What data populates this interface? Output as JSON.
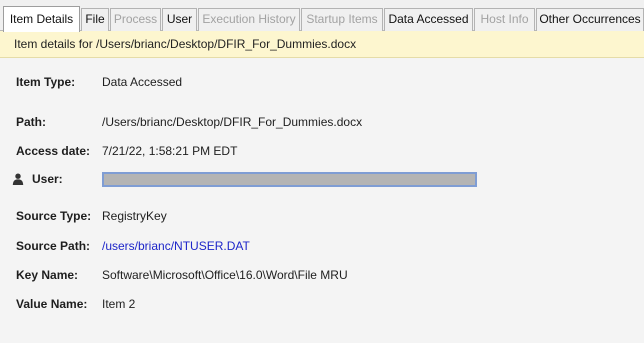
{
  "tabs": [
    {
      "label": "Item Details",
      "state": "active"
    },
    {
      "label": "File",
      "state": "enabled"
    },
    {
      "label": "Process",
      "state": "disabled"
    },
    {
      "label": "User",
      "state": "enabled"
    },
    {
      "label": "Execution History",
      "state": "disabled"
    },
    {
      "label": "Startup Items",
      "state": "disabled"
    },
    {
      "label": "Data Accessed",
      "state": "enabled"
    },
    {
      "label": "Host Info",
      "state": "disabled"
    },
    {
      "label": "Other Occurrences",
      "state": "enabled"
    }
  ],
  "banner": {
    "text": "Item details for /Users/brianc/Desktop/DFIR_For_Dummies.docx"
  },
  "details": {
    "item_type": {
      "label": "Item Type:",
      "value": "Data Accessed"
    },
    "path": {
      "label": "Path:",
      "value": "/Users/brianc/Desktop/DFIR_For_Dummies.docx"
    },
    "access_date": {
      "label": "Access date:",
      "value": "7/21/22, 1:58:21 PM EDT"
    },
    "user": {
      "label": "User:",
      "value": "",
      "icon": "user-icon"
    },
    "source_type": {
      "label": "Source Type:",
      "value": "RegistryKey"
    },
    "source_path": {
      "label": "Source Path:",
      "value": "/users/brianc/NTUSER.DAT"
    },
    "key_name": {
      "label": "Key Name:",
      "value": "Software\\Microsoft\\Office\\16.0\\Word\\File MRU"
    },
    "value_name": {
      "label": "Value Name:",
      "value": "Item 2"
    }
  },
  "colors": {
    "banner_bg": "#fdf6cf",
    "link": "#1d25c9",
    "disabled_tab_text": "#a2a2a2",
    "redaction": "#b4b4b4"
  }
}
